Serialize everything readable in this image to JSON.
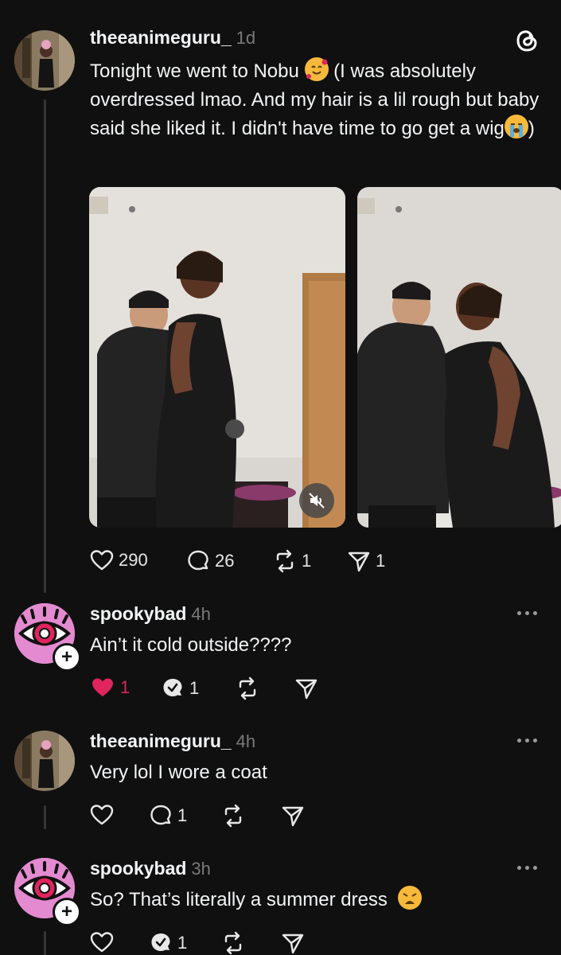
{
  "post": {
    "username": "theeanimeguru_",
    "time": "1d",
    "text_1": "Tonight we went to Nobu",
    "text_2": " (I was absolutely overdressed lmao. And my hair is a lil rough but baby said she liked it. I didn't have time to go get a wig",
    "text_3": ")",
    "likes": "290",
    "comments": "26",
    "reposts": "1",
    "shares": "1"
  },
  "replies": [
    {
      "username": "spookybad",
      "time": "4h",
      "text": "Ain’t it cold outside????",
      "likes": "1",
      "comments": "1"
    },
    {
      "username": "theeanimeguru_",
      "time": "4h",
      "text": "Very lol I wore a coat",
      "comments": "1"
    },
    {
      "username": "spookybad",
      "time": "3h",
      "text": "So? That’s literally a summer dress",
      "comments": "1"
    }
  ],
  "colors": {
    "background": "#101010",
    "like_red": "#e0245e",
    "muted": "#7a7a7a"
  }
}
